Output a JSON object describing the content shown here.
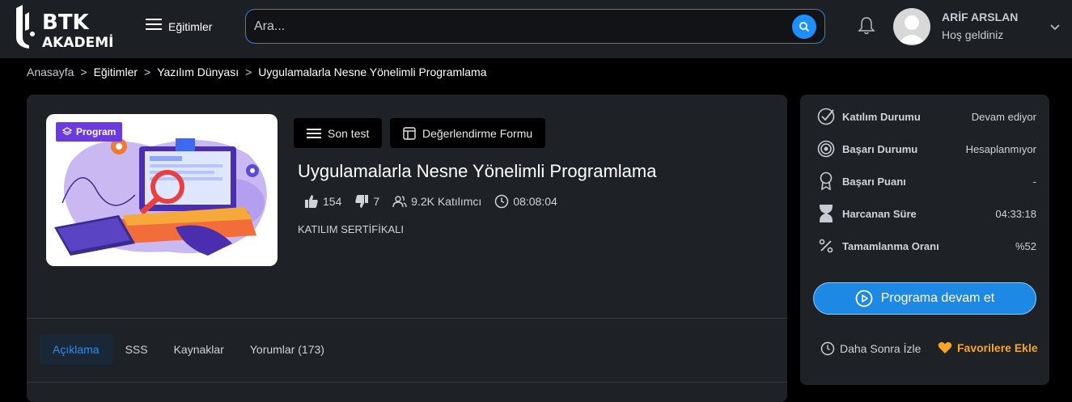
{
  "header": {
    "logo_text_top": "BTK",
    "logo_text_bottom": "AKADEMİ",
    "menu_label": "Eğitimler",
    "search_placeholder": "Ara...",
    "user_name": "ARİF ARSLAN",
    "user_greeting": "Hoş geldiniz"
  },
  "breadcrumb": [
    "Anasayfa",
    "Eğitimler",
    "Yazılım Dünyası",
    "Uygulamalarla Nesne Yönelimli Programlama"
  ],
  "breadcrumb_separator": ">",
  "course": {
    "tag": "Program",
    "actions": [
      "Son test",
      "Değerlendirme Formu"
    ],
    "title": "Uygulamalarla Nesne Yönelimli Programlama",
    "likes": "154",
    "dislikes": "7",
    "participants": "9.2K Katılımcı",
    "duration": "08:08:04",
    "certificate": "KATILIM SERTİFİKALI"
  },
  "tabs": [
    {
      "label": "Açıklama",
      "active": true
    },
    {
      "label": "SSS",
      "active": false
    },
    {
      "label": "Kaynaklar",
      "active": false
    },
    {
      "label": "Yorumlar (173)",
      "active": false
    }
  ],
  "status": {
    "rows": [
      {
        "icon": "check-circle-icon",
        "label": "Katılım Durumu",
        "value": "Devam ediyor"
      },
      {
        "icon": "target-icon",
        "label": "Başarı Durumu",
        "value": "Hesaplanmıyor"
      },
      {
        "icon": "award-icon",
        "label": "Başarı Puanı",
        "value": "-"
      },
      {
        "icon": "hourglass-icon",
        "label": "Harcanan Süre",
        "value": "04:33:18"
      },
      {
        "icon": "percent-icon",
        "label": "Tamamlanma Oranı",
        "value": "%52"
      }
    ],
    "cta_label": "Programa devam et",
    "watch_later_label": "Daha Sonra İzle",
    "favorite_label": "Favorilere Ekle"
  },
  "colors": {
    "accent": "#1e88e5",
    "favorite": "#f5a623",
    "tag": "#6b3be0",
    "panel": "#1e2126"
  }
}
